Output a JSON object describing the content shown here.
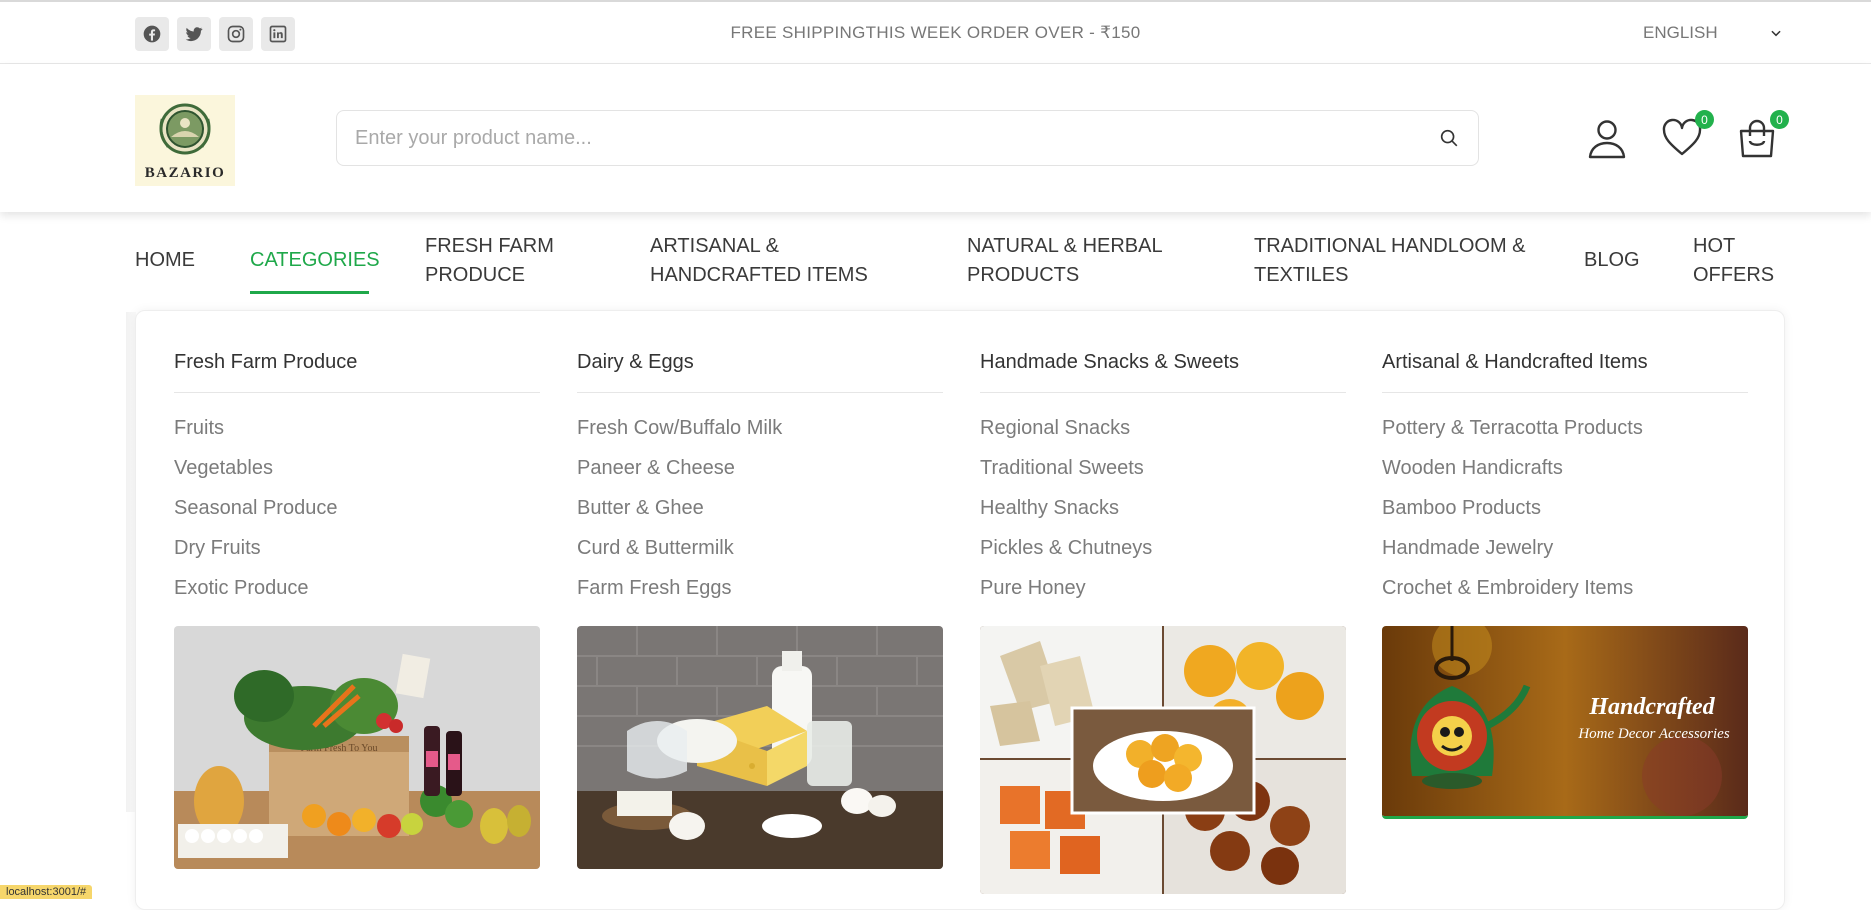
{
  "topbar": {
    "socials": [
      {
        "icon": "facebook-icon"
      },
      {
        "icon": "twitter-icon"
      },
      {
        "icon": "instagram-icon"
      },
      {
        "icon": "linkedin-icon"
      }
    ],
    "promo": "FREE SHIPPINGTHIS WEEK ORDER OVER - ₹150",
    "language": "ENGLISH"
  },
  "header": {
    "logo_text": "BAZARIO",
    "search_placeholder": "Enter your product name...",
    "wishlist_count": "0",
    "cart_count": "0"
  },
  "nav": {
    "items": [
      {
        "label": "HOME"
      },
      {
        "label": "CATEGORIES"
      },
      {
        "label": "FRESH FARM",
        "label2": "PRODUCE"
      },
      {
        "label": "ARTISANAL &",
        "label2": "HANDCRAFTED ITEMS"
      },
      {
        "label": "NATURAL & HERBAL",
        "label2": "PRODUCTS"
      },
      {
        "label": "TRADITIONAL HANDLOOM &",
        "label2": "TEXTILES"
      },
      {
        "label": "BLOG"
      },
      {
        "label": "HOT",
        "label2": "OFFERS"
      }
    ],
    "active_color": "#1fa84a"
  },
  "mega_menu": {
    "columns": [
      {
        "title": "Fresh Farm Produce",
        "items": [
          "Fruits",
          "Vegetables",
          "Seasonal Produce",
          "Dry Fruits",
          "Exotic Produce"
        ]
      },
      {
        "title": "Dairy & Eggs",
        "items": [
          "Fresh Cow/Buffalo Milk",
          "Paneer & Cheese",
          "Butter & Ghee",
          "Curd & Buttermilk",
          "Farm Fresh Eggs"
        ]
      },
      {
        "title": "Handmade Snacks & Sweets",
        "items": [
          "Regional Snacks",
          "Traditional Sweets",
          "Healthy Snacks",
          "Pickles & Chutneys",
          "Pure Honey"
        ]
      },
      {
        "title": "Artisanal & Handcrafted Items",
        "items": [
          "Pottery & Terracotta Products",
          "Wooden Handicrafts",
          "Bamboo Products",
          "Handmade Jewelry",
          "Crochet & Embroidery Items"
        ]
      }
    ],
    "banner_text": {
      "line1": "Handcrafted",
      "line2": "Home Decor Accessories"
    },
    "produce_box_text": "Farm Fresh To You"
  },
  "status_bar": "localhost:3001/#"
}
